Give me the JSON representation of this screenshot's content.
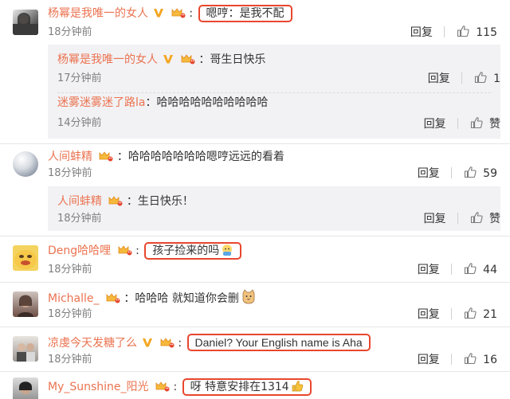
{
  "comments": [
    {
      "user": "杨幂是我唯一的女人",
      "text": "嗯哼：是我不配",
      "time": "18分钟前",
      "reply_label": "回复",
      "likes": "115",
      "colors": {
        "username": "#eb7350",
        "highlight": "#e8472e"
      },
      "replies": [
        {
          "user": "杨幂是我唯一的女人",
          "text": "哥生日快乐",
          "time": "17分钟前",
          "reply_label": "回复",
          "likes": "1"
        },
        {
          "user": "迷雾迷雾迷了路la",
          "text": "哈哈哈哈哈哈哈哈哈哈",
          "time": "14分钟前",
          "reply_label": "回复",
          "likes": "赞"
        }
      ]
    },
    {
      "user": "人间蚌精",
      "text": "哈哈哈哈哈哈哈嗯哼远远的看着",
      "time": "18分钟前",
      "reply_label": "回复",
      "likes": "59",
      "replies": [
        {
          "user": "人间蚌精",
          "text": "生日快乐！",
          "time": "18分钟前",
          "reply_label": "回复",
          "likes": "赞"
        }
      ]
    },
    {
      "user": "Deng哈哈哩",
      "text": "孩子捡来的吗",
      "time": "18分钟前",
      "reply_label": "回复",
      "likes": "44"
    },
    {
      "user": "Michalle_",
      "text": "哈哈哈 就知道你会删",
      "time": "18分钟前",
      "reply_label": "回复",
      "likes": "21"
    },
    {
      "user": "凉虔今天发糖了么",
      "text": "Daniel? Your English name is Aha",
      "time": "18分钟前",
      "reply_label": "回复",
      "likes": "16"
    },
    {
      "user": "My_Sunshine_阳光",
      "text": "呀 特意安排在1314"
    }
  ],
  "icons": {
    "like": "thumbs-up-icon",
    "verified": "verified-v-icon",
    "member": "member-crown-icon"
  }
}
